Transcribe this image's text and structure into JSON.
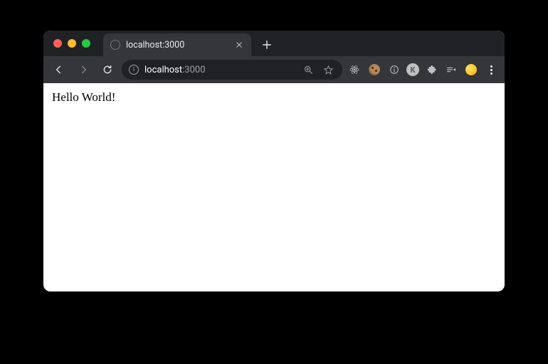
{
  "tab": {
    "title": "localhost:3000"
  },
  "omnibox": {
    "host": "localhost",
    "port": ":3000"
  },
  "extensions": {
    "avatar_letter": "K"
  },
  "page": {
    "body_text": "Hello World!"
  }
}
